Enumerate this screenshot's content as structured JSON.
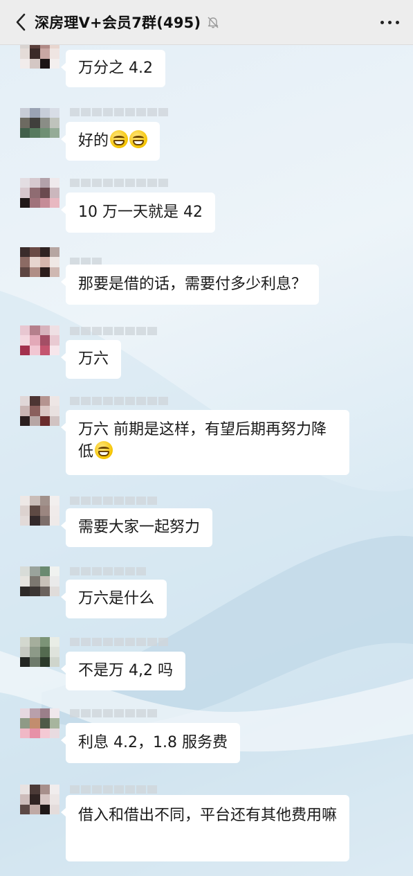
{
  "header": {
    "title": "深房理V+会员7群(495)",
    "back_icon": "chevron-left-icon",
    "mute_icon": "bell-muted-icon",
    "more_icon": "more-dots-icon"
  },
  "messages": [
    {
      "text": "万分之 4.2"
    },
    {
      "text": "好的",
      "emoji_count": 2
    },
    {
      "text": "10 万一天就是 42"
    },
    {
      "text": "那要是借的话，需要付多少利息？"
    },
    {
      "text": "万六"
    },
    {
      "text": "万六 前期是这样，有望后期再努力降低",
      "emoji_count": 1
    },
    {
      "text": "需要大家一起努力"
    },
    {
      "text": "万六是什么"
    },
    {
      "text": "不是万 4,2 吗"
    },
    {
      "text": "利息 4.2，1.8 服务费"
    },
    {
      "text": "借入和借出不同，平台还有其他费用嘛"
    }
  ],
  "colors": {
    "header_bg": "#ededed",
    "bubble_bg": "#ffffff",
    "chat_bg": "#e3eef6"
  }
}
